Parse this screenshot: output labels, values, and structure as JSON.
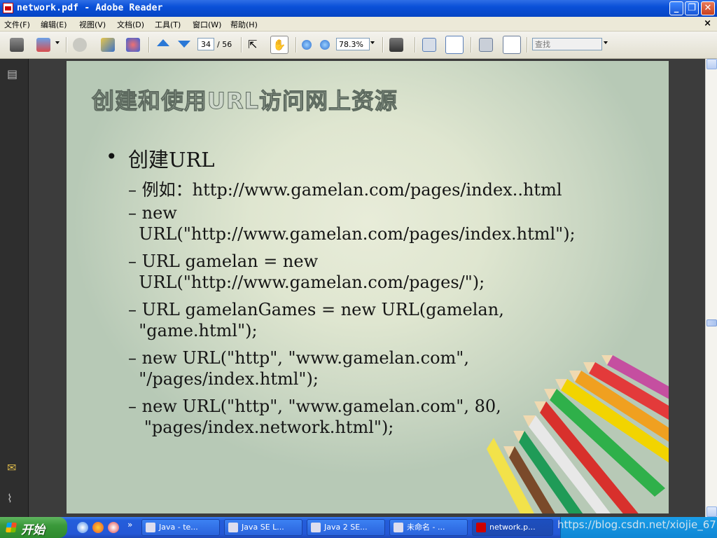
{
  "window": {
    "title": "network.pdf - Adobe Reader",
    "min_glyph": "_",
    "max_glyph": "❐",
    "close_glyph": "✕"
  },
  "menu": {
    "items": [
      "文件(F)",
      "编辑(E)",
      "视图(V)",
      "文档(D)",
      "工具(T)",
      "窗口(W)",
      "帮助(H)"
    ],
    "close_glyph": "×"
  },
  "toolbar": {
    "page_current": "34",
    "page_total": "/ 56",
    "zoom": "78.3%",
    "search_placeholder": "查找"
  },
  "slide": {
    "title": "创建和使用URL访问网上资源",
    "bullet": "创建URL",
    "lines": [
      "– 例如：http://www.gamelan.com/pages/index..html",
      "– new",
      "  URL(\"http://www.gamelan.com/pages/index.html\");",
      "– URL gamelan = new",
      "  URL(\"http://www.gamelan.com/pages/\");",
      "– URL gamelanGames = new URL(gamelan,",
      "  \"game.html\");",
      "– new URL(\"http\", \"www.gamelan.com\",",
      "  \"/pages/index.html\");",
      "– new URL(\"http\", \"www.gamelan.com\", 80,",
      "   \"pages/index.network.html\");"
    ]
  },
  "taskbar": {
    "start_label": "开始",
    "more_glyph": "»",
    "tasks": [
      "Java - te...",
      "Java SE L...",
      "Java 2 SE...",
      "未命名 - ...",
      "network.p..."
    ]
  },
  "watermark": "https://blog.csdn.net/xiojie_67",
  "colors": {
    "titlebar": "#0a50d8",
    "taskbar": "#245edb",
    "start": "#3a993a",
    "slide_bg": "#dfe6d0"
  },
  "icons": [
    "app-pdf-icon",
    "print-icon",
    "email-icon",
    "hand-icon",
    "select-icon",
    "zoom-in-icon",
    "zoom-out-icon",
    "snapshot-icon",
    "pages-icon",
    "comment-icon",
    "attach-icon"
  ]
}
